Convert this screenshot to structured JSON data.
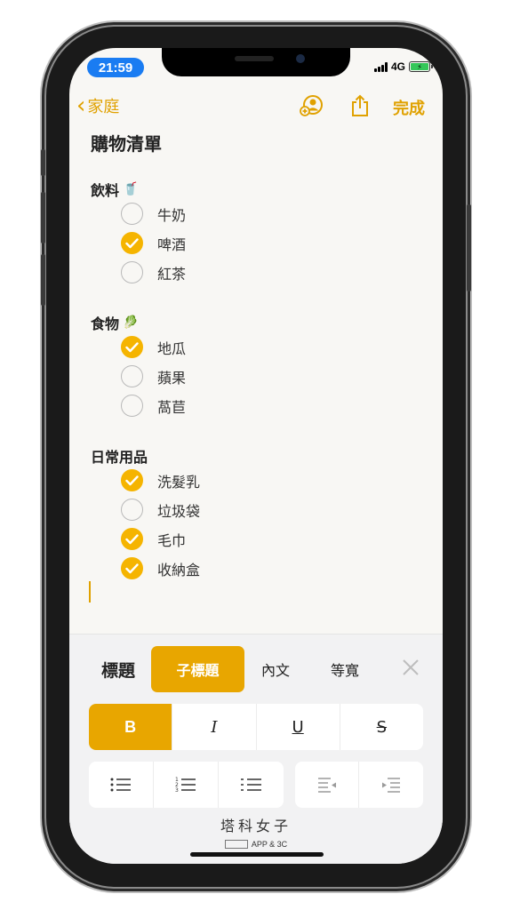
{
  "status": {
    "time": "21:59",
    "network": "4G"
  },
  "nav": {
    "back_label": "家庭",
    "done_label": "完成"
  },
  "note": {
    "title": "購物清單",
    "sections": [
      {
        "heading": "飲料",
        "emoji": "🥤",
        "items": [
          {
            "label": "牛奶",
            "checked": false
          },
          {
            "label": "啤酒",
            "checked": true
          },
          {
            "label": "紅茶",
            "checked": false
          }
        ]
      },
      {
        "heading": "食物",
        "emoji": "🥬",
        "items": [
          {
            "label": "地瓜",
            "checked": true
          },
          {
            "label": "蘋果",
            "checked": false
          },
          {
            "label": "萵苣",
            "checked": false
          }
        ]
      },
      {
        "heading": "日常用品",
        "emoji": "",
        "items": [
          {
            "label": "洗髮乳",
            "checked": true
          },
          {
            "label": "垃圾袋",
            "checked": false
          },
          {
            "label": "毛巾",
            "checked": true
          },
          {
            "label": "收納盒",
            "checked": true
          }
        ]
      }
    ]
  },
  "format": {
    "styles": [
      "標題",
      "子標題",
      "內文",
      "等寬"
    ],
    "active_style": "子標題",
    "text_styles": {
      "bold": "B",
      "italic": "I",
      "underline": "U",
      "strike": "S"
    },
    "list_icons": [
      "bulleted-list-icon",
      "numbered-list-icon",
      "dashed-list-icon",
      "outdent-icon",
      "indent-icon"
    ]
  },
  "watermark": {
    "title": "塔科女子",
    "subtitle": "APP & 3C"
  },
  "colors": {
    "accent": "#e8a600",
    "check": "#f5b400",
    "time_pill": "#1a7cf2"
  }
}
